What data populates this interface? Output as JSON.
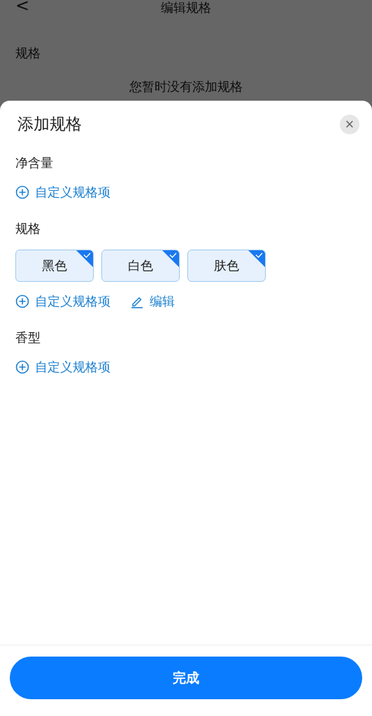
{
  "page": {
    "title": "编辑规格",
    "back": "<",
    "section_label": "规格",
    "empty_text": "您暂时没有添加规格"
  },
  "sheet": {
    "title": "添加规格",
    "close": "×",
    "groups": [
      {
        "title": "净含量",
        "add_label": "自定义规格项"
      },
      {
        "title": "规格",
        "options": [
          {
            "label": "黑色",
            "selected": true
          },
          {
            "label": "白色",
            "selected": true
          },
          {
            "label": "肤色",
            "selected": true
          }
        ],
        "add_label": "自定义规格项",
        "edit_label": "编辑"
      },
      {
        "title": "香型",
        "add_label": "自定义规格项"
      }
    ],
    "done_button": "完成"
  }
}
